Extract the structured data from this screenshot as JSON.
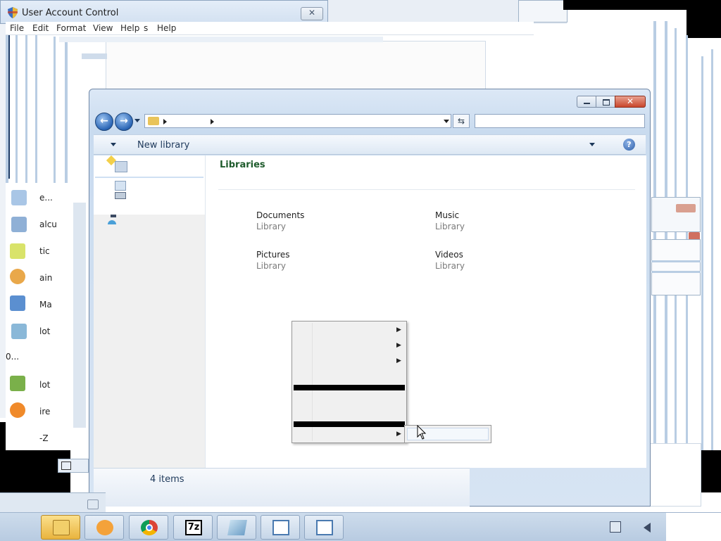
{
  "uac": {
    "title": "User Account Control",
    "close_glyph": "✕"
  },
  "menubar": {
    "items": [
      "File",
      "Edit",
      "Format",
      "View",
      "Help",
      "s",
      "Help"
    ]
  },
  "left_fragments": [
    "e...",
    "alcu",
    "tic",
    "ain",
    "Ma",
    "lot",
    "0...",
    "lot",
    "ire",
    "-Z"
  ],
  "explorer": {
    "close_glyph": "✕",
    "back_glyph": "←",
    "forward_glyph": "→",
    "refresh_glyph": "⇆",
    "command_bar_label": "New library",
    "help_glyph": "?",
    "content_title": "Libraries",
    "libraries": [
      {
        "name": "Documents",
        "type": "Library"
      },
      {
        "name": "Music",
        "type": "Library"
      },
      {
        "name": "Pictures",
        "type": "Library"
      },
      {
        "name": "Videos",
        "type": "Library"
      }
    ],
    "status": "4 items"
  },
  "context_menu": {
    "arrow_glyph": "▶"
  },
  "taskbar": {
    "buttons": [
      {
        "icon": "file-explorer-icon",
        "color": "#e6b54a"
      },
      {
        "icon": "media-player-icon",
        "color": "#e88a2a"
      },
      {
        "icon": "chrome-icon",
        "color": "#3c8be0"
      },
      {
        "icon": "7zip-icon",
        "label": "7z"
      },
      {
        "icon": "notepad-icon",
        "color": "#6fa0c8"
      },
      {
        "icon": "window-app-icon",
        "color": "#4a7ab0"
      },
      {
        "icon": "window-app-icon",
        "color": "#4a7ab0"
      }
    ]
  }
}
